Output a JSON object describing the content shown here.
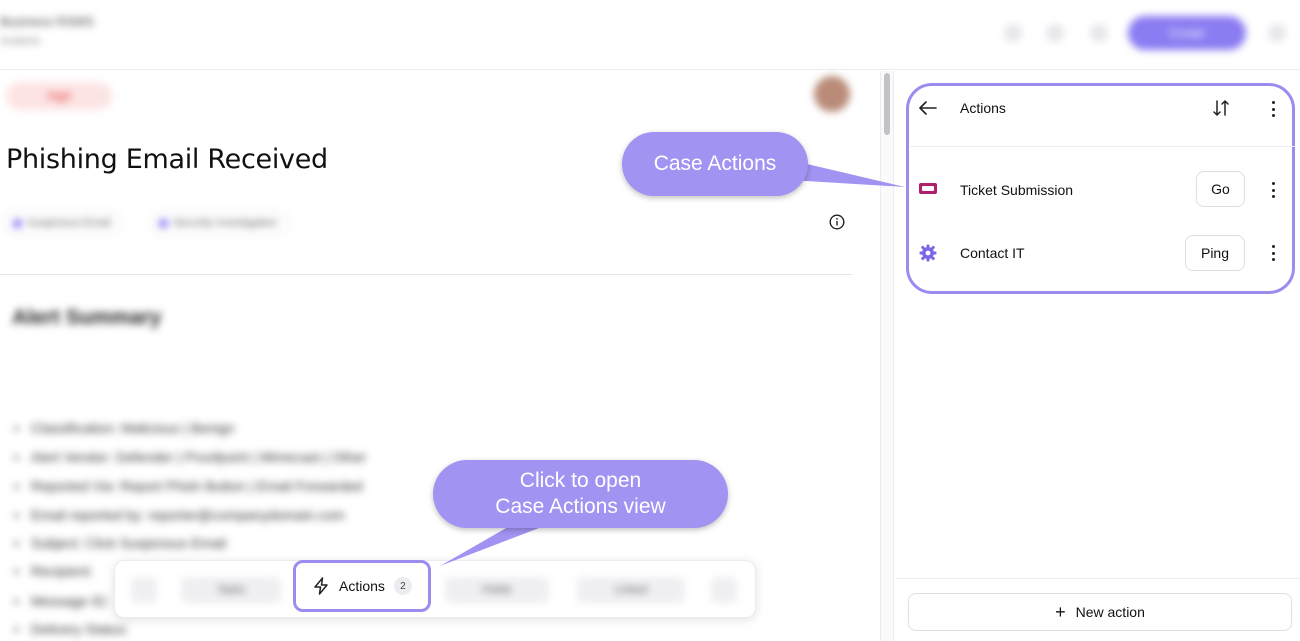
{
  "topbar": {
    "title": "Business RSMS",
    "subtitle": "Incidents",
    "cta_label": "Create"
  },
  "case": {
    "severity": "High",
    "title": "Phishing Email Received",
    "tags": [
      "Suspicious Email",
      "Security Investigation"
    ]
  },
  "summary": {
    "heading": "Alert Summary",
    "bullets": [
      "Classification: Malicious | Benign",
      "Alert Vendor: Defender | Proofpoint | Mimecast | Other",
      "Reported Via: Report Phish Button | Email Forwarded",
      "Email reported by: reporter@companydomain.com",
      "Subject: Click Suspicious Email",
      "Recipient:",
      "Message ID:",
      "Delivery Status:"
    ]
  },
  "toolbar": {
    "items": [
      "Tasks",
      "Actions",
      "Fields",
      "Linked"
    ],
    "actions_label": "Actions",
    "actions_count": "2"
  },
  "panel": {
    "title": "Actions",
    "rows": [
      {
        "label": "Ticket Submission",
        "button": "Go"
      },
      {
        "label": "Contact IT",
        "button": "Ping"
      }
    ],
    "new_action_label": "New action"
  },
  "callouts": {
    "case_actions": "Case Actions",
    "open_line1": "Click to open",
    "open_line2": "Case Actions view"
  },
  "colors": {
    "accent": "#9b8cf0",
    "callout": "#a193f2",
    "ticket_icon": "#b0216b"
  }
}
